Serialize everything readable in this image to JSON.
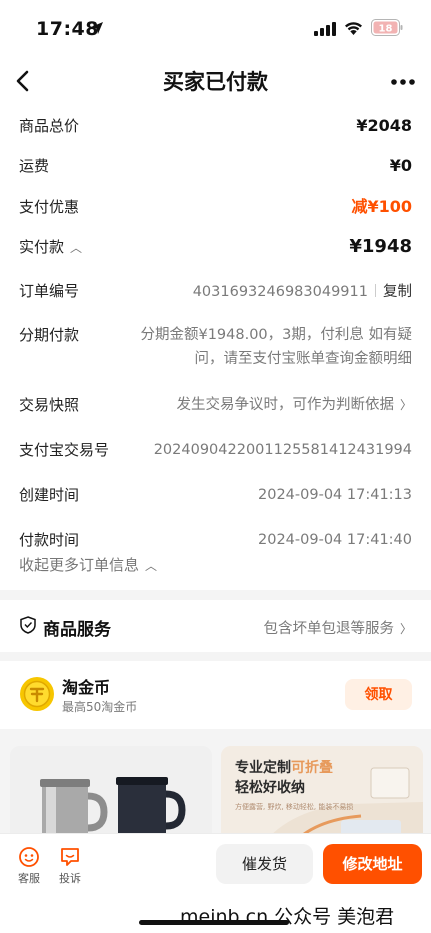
{
  "status_bar": {
    "time": "17:48",
    "battery": "18"
  },
  "nav": {
    "title": "买家已付款"
  },
  "order": {
    "total_label": "商品总价",
    "total_value": "¥2048",
    "shipping_label": "运费",
    "shipping_value": "¥0",
    "discount_label": "支付优惠",
    "discount_value": "减¥100",
    "paid_label": "实付款",
    "paid_value": "¥1948",
    "order_no_label": "订单编号",
    "order_no_value": "4031693246983049911",
    "copy_label": "复制",
    "installment_label": "分期付款",
    "installment_line1": "分期金额¥1948.00，3期，付利息 如有疑",
    "installment_line2": "问，请至支付宝账单查询金额明细",
    "snapshot_label": "交易快照",
    "snapshot_value": "发生交易争议时，可作为判断依据",
    "alipay_no_label": "支付宝交易号",
    "alipay_no_value": "2024090422001125581412431994",
    "created_label": "创建时间",
    "created_value": "2024-09-04 17:41:13",
    "paid_time_label": "付款时间",
    "paid_time_value": "2024-09-04 17:41:40",
    "collapse_label": "收起更多订单信息"
  },
  "service": {
    "title": "商品服务",
    "link": "包含坏单包退等服务"
  },
  "coins": {
    "title": "淘金币",
    "subtitle": "最高50淘金币",
    "button": "领取"
  },
  "recommend": {
    "right_line1a": "专业定制",
    "right_line1b": "可折叠",
    "right_line2": "轻松好收纳",
    "right_tiny": "方便露营, 野炊, 移动轻松, 能装不易损"
  },
  "bottom": {
    "service_label": "客服",
    "complaint_label": "投诉",
    "urge_label": "催发货",
    "address_label": "修改地址",
    "watermark": "meinb.cn 公众号 美泡君"
  },
  "colors": {
    "accent": "#ff5000",
    "page_bg": "#f4f4f4",
    "coin": "#f7c600"
  },
  "icons": [
    "location-arrow-icon",
    "signal-icon",
    "wifi-icon",
    "battery-icon",
    "back-icon",
    "more-icon",
    "chevron-up-icon",
    "chevron-right-icon",
    "shield-icon",
    "coin-icon",
    "customer-service-icon",
    "complaint-icon"
  ]
}
